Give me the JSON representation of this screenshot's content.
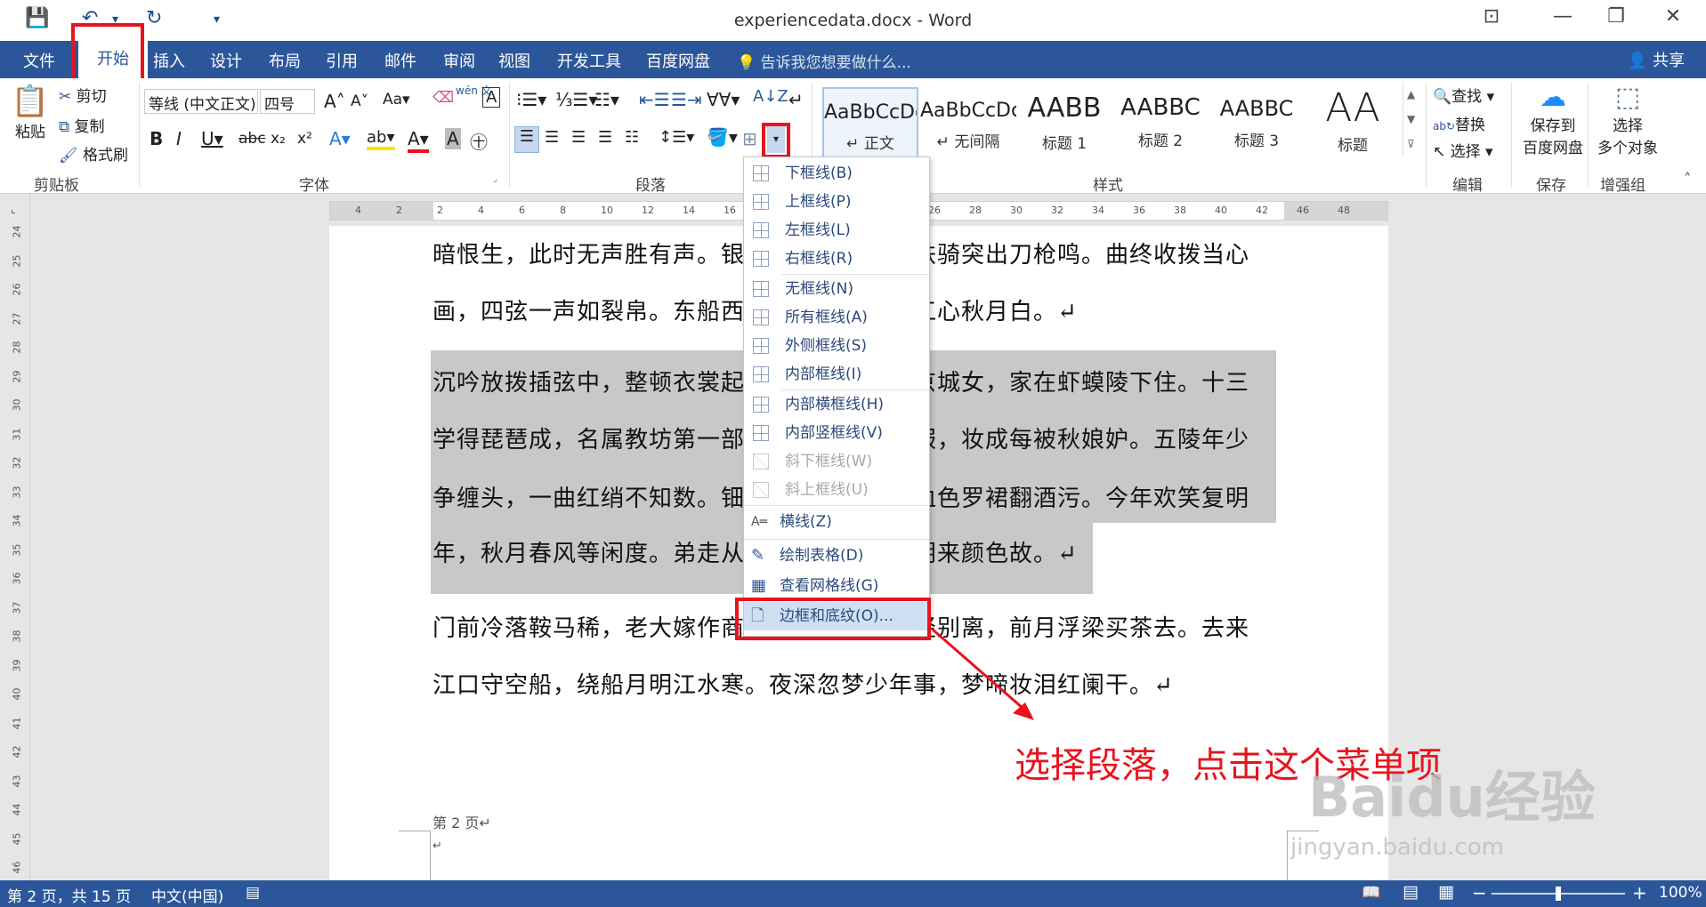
{
  "window": {
    "title": "experiencedata.docx - Word",
    "controls": [
      "⊡",
      "—",
      "❐",
      "✕"
    ]
  },
  "tabs": [
    "文件",
    "开始",
    "插入",
    "设计",
    "布局",
    "引用",
    "邮件",
    "审阅",
    "视图",
    "开发工具",
    "百度网盘"
  ],
  "tell_me": "告诉我您想要做什么...",
  "share": "共享",
  "clipboard": {
    "paste": "粘贴",
    "cut": "剪切",
    "copy": "复制",
    "format_painter": "格式刷",
    "label": "剪贴板"
  },
  "font": {
    "name": "等线 (中文正文)",
    "size": "四号",
    "label": "字体",
    "wen": "wén 文",
    "a_large": "A",
    "a_small": "A"
  },
  "paragraph": {
    "label": "段落"
  },
  "styles": {
    "label": "样式",
    "items": [
      {
        "sample": "AaBbCcDc",
        "name": "↵ 正文"
      },
      {
        "sample": "AaBbCcDc",
        "name": "↵ 无间隔"
      },
      {
        "sample": "AABB",
        "name": "标题 1"
      },
      {
        "sample": "AABBC",
        "name": "标题 2"
      },
      {
        "sample": "AABBC",
        "name": "标题 3"
      },
      {
        "sample": "AA",
        "name": "标题"
      }
    ]
  },
  "editing": {
    "find": "查找",
    "replace": "替换",
    "select": "选择",
    "label": "编辑"
  },
  "save_group": {
    "btn": "保存到\n百度网盘",
    "btn1": "保存到",
    "btn2": "百度网盘",
    "label": "保存"
  },
  "enhance": {
    "btn1": "选择",
    "btn2": "多个对象",
    "label": "增强组"
  },
  "ruler": {
    "ticks": [
      "4",
      "2",
      "2",
      "4",
      "6",
      "8",
      "10",
      "12",
      "14",
      "16",
      "18",
      "20",
      "22",
      "24",
      "26",
      "28",
      "30",
      "32",
      "34",
      "36",
      "38",
      "40",
      "42",
      "46",
      "48"
    ],
    "vticks": [
      "24",
      "25",
      "26",
      "27",
      "28",
      "29",
      "30",
      "31",
      "32",
      "33",
      "34",
      "35",
      "36",
      "37",
      "38",
      "39",
      "40",
      "41",
      "42",
      "43",
      "44",
      "45",
      "46"
    ]
  },
  "document": {
    "lines": [
      "暗恨生，此时无声胜有声。银瓶乍破水浆迸，铁骑突出刀枪鸣。曲终收拨当心",
      "画，四弦一声如裂帛。东船西舫悄无言，唯见江心秋月白。↵",
      "沉吟放拨插弦中，整顿衣裳起敛容。自言本是京城女，家在虾蟆陵下住。十三",
      "学得琵琶成，名属教坊第一部。曲罢曾教善才服，妆成每被秋娘妒。五陵年少",
      "争缠头，一曲红绡不知数。钿头银篦击节碎，血色罗裙翻酒污。今年欢笑复明",
      "年，秋月春风等闲度。弟走从军阿姨死，暮去朝来颜色故。↵",
      "门前冷落鞍马稀，老大嫁作商人妇。商人重利轻别离，前月浮梁买茶去。去来",
      "江口守空船，绕船月明江水寒。夜深忽梦少年事，梦啼妆泪红阑干。↵"
    ],
    "footer": "第 2 页↵",
    "footer_mark": "↵"
  },
  "menu": [
    {
      "label": "下框线(B)",
      "enabled": true
    },
    {
      "label": "上框线(P)",
      "enabled": true
    },
    {
      "label": "左框线(L)",
      "enabled": true
    },
    {
      "label": "右框线(R)",
      "enabled": true
    },
    {
      "label": "无框线(N)",
      "enabled": true
    },
    {
      "label": "所有框线(A)",
      "enabled": true
    },
    {
      "label": "外侧框线(S)",
      "enabled": true
    },
    {
      "label": "内部框线(I)",
      "enabled": true
    },
    {
      "label": "内部横框线(H)",
      "enabled": true
    },
    {
      "label": "内部竖框线(V)",
      "enabled": true
    },
    {
      "label": "斜下框线(W)",
      "enabled": false
    },
    {
      "label": "斜上框线(U)",
      "enabled": false
    },
    {
      "label": "横线(Z)",
      "enabled": true
    },
    {
      "label": "绘制表格(D)",
      "enabled": true
    },
    {
      "label": "查看网格线(G)",
      "enabled": true
    },
    {
      "label": "边框和底纹(O)...",
      "enabled": true
    }
  ],
  "annotation": "选择段落，点击这个菜单项",
  "status": {
    "page": "第 2 页，共 15 页",
    "lang": "中文(中国)",
    "zoom": "100%",
    "minus": "−",
    "plus": "+"
  },
  "watermark": {
    "brand": "Baidu经验",
    "url": "jingyan.baidu.com"
  },
  "colors": {
    "accent": "#2b579a",
    "highlight_box": "#e8131d"
  }
}
